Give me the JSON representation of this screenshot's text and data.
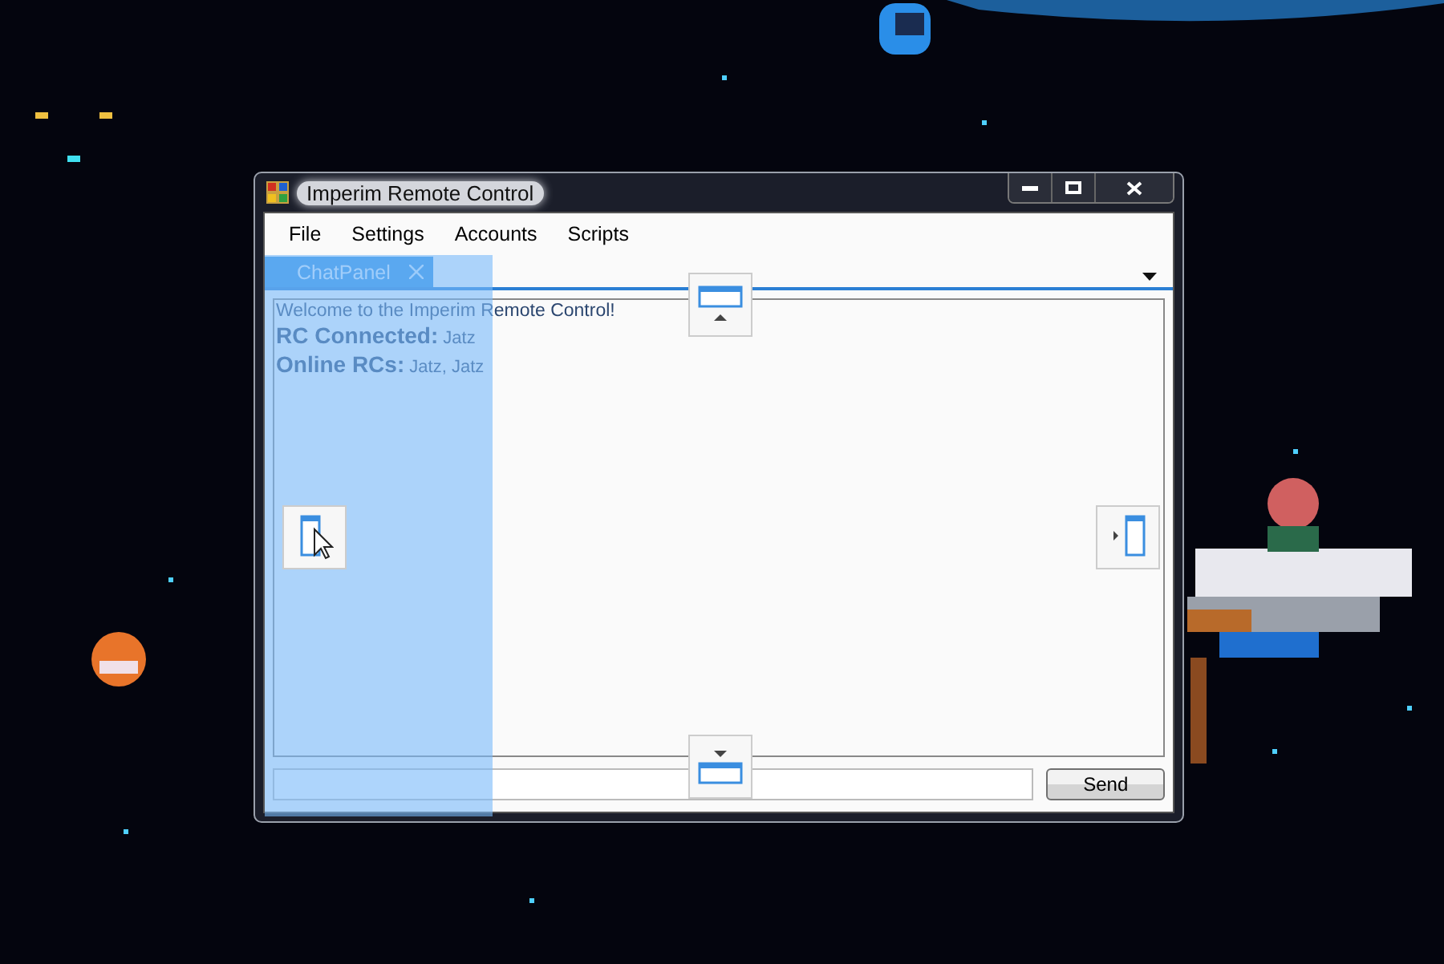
{
  "window": {
    "title": "Imperim Remote Control"
  },
  "menu": [
    {
      "label": "File"
    },
    {
      "label": "Settings"
    },
    {
      "label": "Accounts"
    },
    {
      "label": "Scripts"
    }
  ],
  "tabs": [
    {
      "label": "ChatPanel",
      "selected": true
    }
  ],
  "chat": [
    {
      "kind": "notice",
      "text": "Welcome to the Imperim Remote Control!"
    },
    {
      "kind": "status",
      "text": "**RC Connected:** Jatz"
    },
    {
      "kind": "status",
      "text": "**Online RCs:** Jatz, Jatz"
    }
  ],
  "dock_guides": [
    {
      "kind": "top"
    },
    {
      "kind": "left"
    },
    {
      "kind": "right"
    },
    {
      "kind": "bottom"
    }
  ],
  "send_button": {
    "label": "Send"
  }
}
